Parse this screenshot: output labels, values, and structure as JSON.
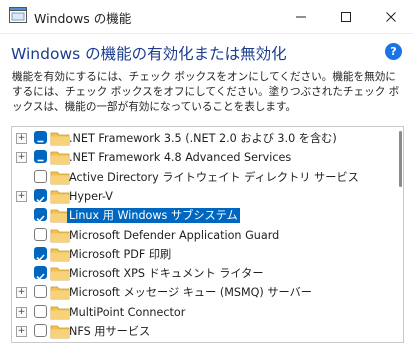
{
  "window": {
    "title": "Windows の機能",
    "min_glyph": "—",
    "max_glyph": "☐",
    "close_glyph": "✕"
  },
  "heading": "Windows の機能の有効化または無効化",
  "help_glyph": "?",
  "description": "機能を有効にするには、チェック ボックスをオンにしてください。機能を無効にするには、チェック ボックスをオフにしてください。塗りつぶされたチェック ボックスは、機能の一部が有効になっていることを表します。",
  "features": [
    {
      "label": ".NET Framework 3.5 (.NET 2.0 および 3.0 を含む)",
      "state": "partial",
      "expandable": true,
      "selected": false
    },
    {
      "label": ".NET Framework 4.8 Advanced Services",
      "state": "partial",
      "expandable": true,
      "selected": false
    },
    {
      "label": "Active Directory ライトウェイト ディレクトリ サービス",
      "state": "unchecked",
      "expandable": false,
      "selected": false
    },
    {
      "label": "Hyper-V",
      "state": "checked",
      "expandable": true,
      "selected": false
    },
    {
      "label": "Linux 用 Windows サブシステム",
      "state": "checked",
      "expandable": false,
      "selected": true
    },
    {
      "label": "Microsoft Defender Application Guard",
      "state": "unchecked",
      "expandable": false,
      "selected": false
    },
    {
      "label": "Microsoft PDF 印刷",
      "state": "checked",
      "expandable": false,
      "selected": false
    },
    {
      "label": "Microsoft XPS ドキュメント ライター",
      "state": "checked",
      "expandable": false,
      "selected": false
    },
    {
      "label": "Microsoft メッセージ キュー (MSMQ) サーバー",
      "state": "unchecked",
      "expandable": true,
      "selected": false
    },
    {
      "label": "MultiPoint Connector",
      "state": "unchecked",
      "expandable": true,
      "selected": false
    },
    {
      "label": "NFS 用サービス",
      "state": "unchecked",
      "expandable": true,
      "selected": false
    }
  ],
  "colors": {
    "accent": "#0067c0",
    "heading": "#1a3d8f",
    "folder": "#f2c14e"
  },
  "icons": {
    "expander": "plus-icon",
    "folder": "folder-icon",
    "check": "checkmark-icon",
    "help": "help-icon"
  }
}
